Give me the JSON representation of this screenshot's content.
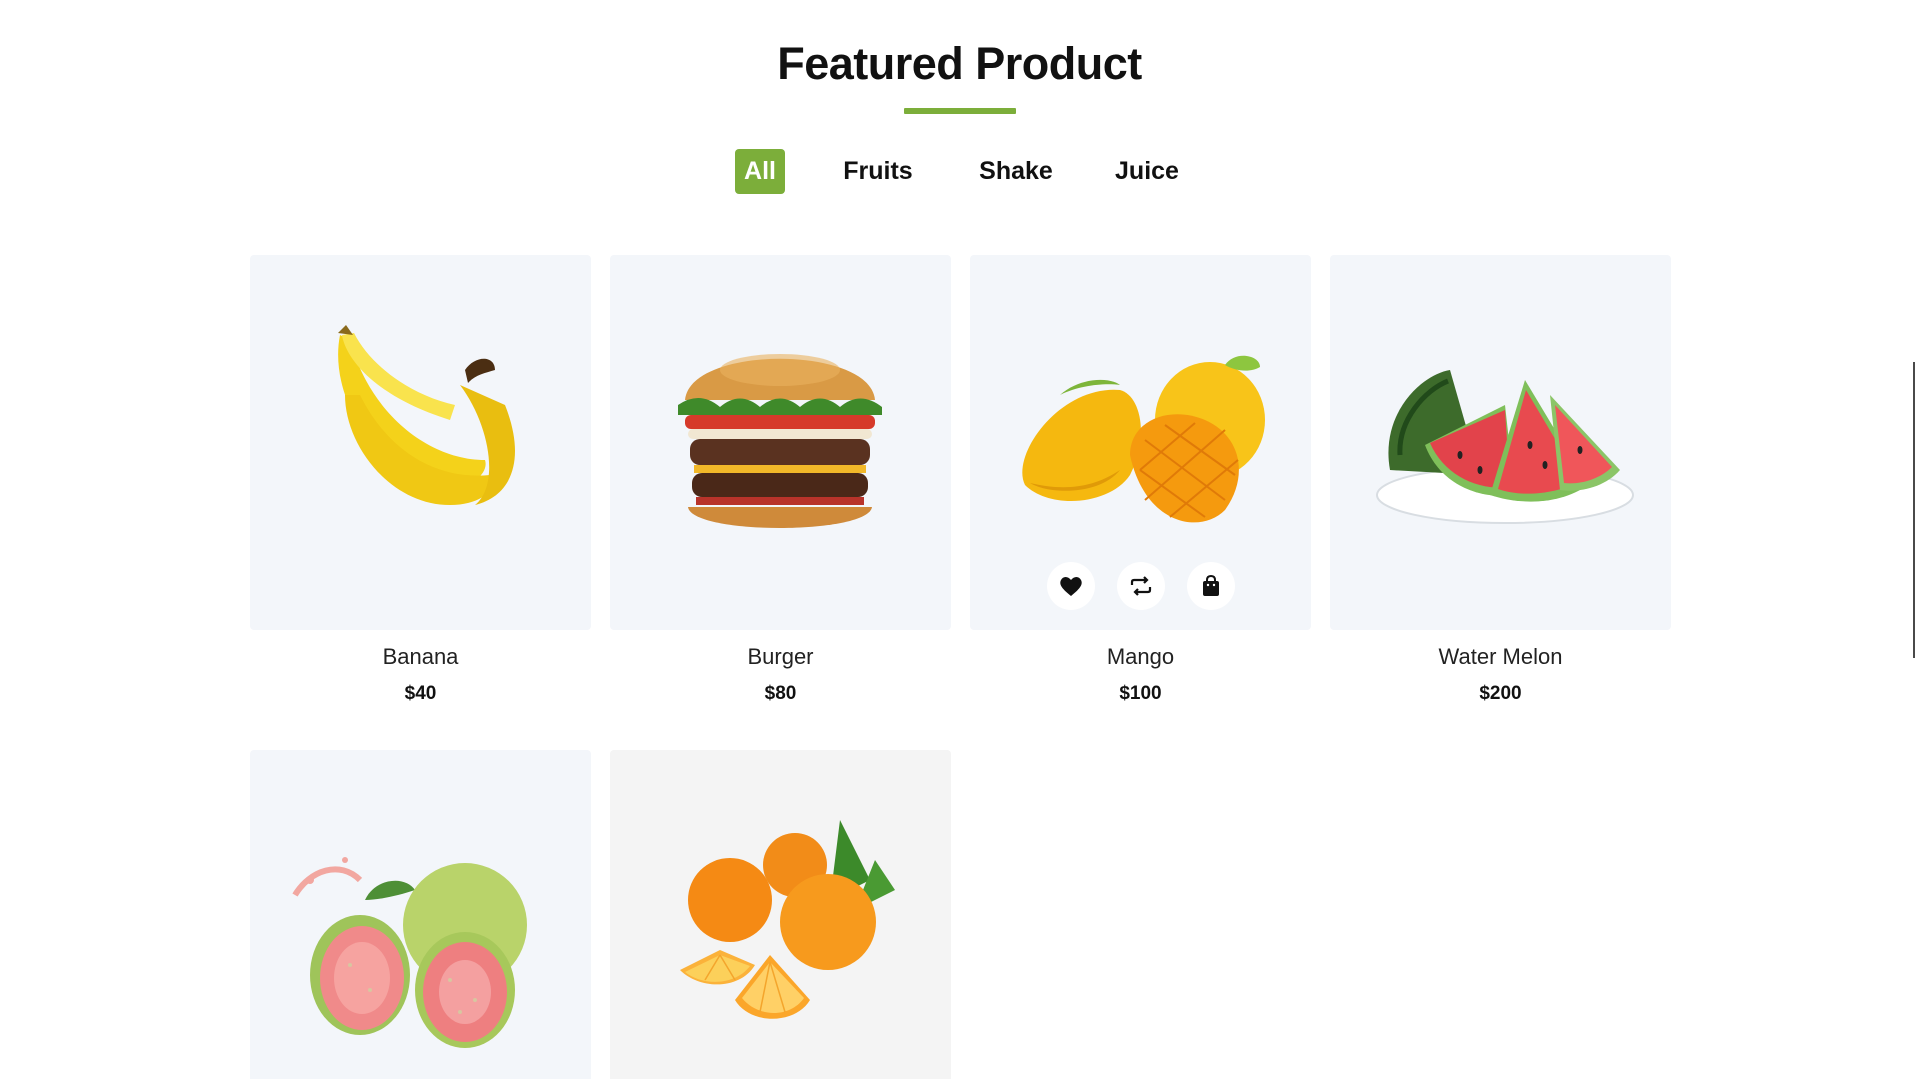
{
  "section": {
    "title": "Featured Product"
  },
  "filters": [
    {
      "label": "All",
      "active": true
    },
    {
      "label": "Fruits",
      "active": false
    },
    {
      "label": "Shake",
      "active": false
    },
    {
      "label": "Juice",
      "active": false
    }
  ],
  "products": [
    {
      "name": "Banana",
      "price": "$40",
      "image": "banana-image"
    },
    {
      "name": "Burger",
      "price": "$80",
      "image": "burger-image"
    },
    {
      "name": "Mango",
      "price": "$100",
      "image": "mango-image",
      "actions": [
        "heart-icon",
        "compare-icon",
        "shopping-bag-icon"
      ]
    },
    {
      "name": "Water Melon",
      "price": "$200",
      "image": "watermelon-image"
    },
    {
      "name": "",
      "price": "",
      "image": "guava-image"
    },
    {
      "name": "",
      "price": "",
      "image": "orange-image"
    }
  ],
  "colors": {
    "accent": "#7cae3a",
    "card_bg": "#f3f6fa",
    "text": "#111111"
  }
}
